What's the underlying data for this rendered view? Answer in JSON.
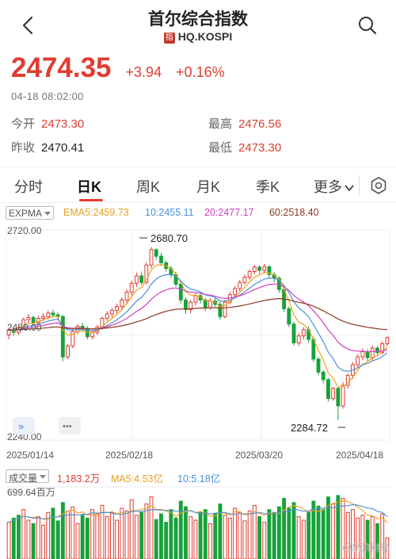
{
  "header": {
    "title": "首尔综合指数",
    "badge": "指",
    "code": "HQ.KOSPI"
  },
  "quote": {
    "price": "2474.35",
    "change": "+3.94",
    "change_pct": "+0.16%",
    "timestamp": "04-18 08:02:00"
  },
  "stats": {
    "open_label": "今开",
    "open_value": "2473.30",
    "prev_label": "昨收",
    "prev_value": "2470.41",
    "high_label": "最高",
    "high_value": "2476.56",
    "low_label": "最低",
    "low_value": "2473.30"
  },
  "tabs": [
    "分时",
    "日K",
    "周K",
    "月K",
    "季K",
    "更多"
  ],
  "active_tab": "日K",
  "indicator": {
    "select": "EXPMA",
    "ema5": "EMA5:2459.73",
    "ema10": "10:2455.11",
    "ema20": "20:2477.17",
    "ema60": "60:2518.40"
  },
  "volume_indicator": {
    "select": "成交量",
    "vol": "1,183.2万",
    "ma5": "MA5:4.53亿",
    "ma10": "10:5.18亿"
  },
  "colors": {
    "up": "#e03c31",
    "down": "#17a23a",
    "ema5": "#f0a020",
    "ema10": "#4a90d9",
    "ema20": "#d040c0",
    "ema60": "#8a3a20"
  },
  "chart_data": {
    "type": "candlestick",
    "y_axis_top": "2720.00",
    "y_axis_bottom": "2240.00",
    "y_axis_mid": "2480.00",
    "ylim": [
      2240,
      2720
    ],
    "high_label": "2680.70",
    "low_label": "2284.72",
    "x_labels": [
      "2025/01/14",
      "2025/02/18",
      "2025/03/20",
      "2025/04/18"
    ],
    "candles": [
      [
        2480,
        2492,
        2470,
        2496
      ],
      [
        2492,
        2486,
        2478,
        2500
      ],
      [
        2486,
        2497,
        2480,
        2505
      ],
      [
        2497,
        2515,
        2492,
        2520
      ],
      [
        2515,
        2520,
        2505,
        2528
      ],
      [
        2520,
        2508,
        2500,
        2525
      ],
      [
        2508,
        2518,
        2502,
        2524
      ],
      [
        2518,
        2522,
        2512,
        2530
      ],
      [
        2522,
        2530,
        2515,
        2536
      ],
      [
        2530,
        2526,
        2520,
        2538
      ],
      [
        2526,
        2522,
        2516,
        2532
      ],
      [
        2522,
        2430,
        2420,
        2526
      ],
      [
        2430,
        2455,
        2425,
        2460
      ],
      [
        2455,
        2488,
        2450,
        2494
      ],
      [
        2488,
        2500,
        2482,
        2505
      ],
      [
        2500,
        2495,
        2488,
        2508
      ],
      [
        2495,
        2476,
        2470,
        2500
      ],
      [
        2476,
        2486,
        2470,
        2492
      ],
      [
        2486,
        2498,
        2480,
        2503
      ],
      [
        2498,
        2518,
        2492,
        2522
      ],
      [
        2518,
        2528,
        2512,
        2534
      ],
      [
        2528,
        2536,
        2520,
        2542
      ],
      [
        2536,
        2545,
        2528,
        2552
      ],
      [
        2545,
        2560,
        2538,
        2566
      ],
      [
        2560,
        2578,
        2552,
        2584
      ],
      [
        2578,
        2598,
        2570,
        2604
      ],
      [
        2598,
        2615,
        2590,
        2622
      ],
      [
        2615,
        2600,
        2594,
        2625
      ],
      [
        2600,
        2640,
        2595,
        2646
      ],
      [
        2640,
        2675,
        2632,
        2681
      ],
      [
        2675,
        2660,
        2652,
        2678
      ],
      [
        2660,
        2645,
        2638,
        2668
      ],
      [
        2645,
        2632,
        2625,
        2650
      ],
      [
        2632,
        2618,
        2610,
        2638
      ],
      [
        2618,
        2596,
        2590,
        2624
      ],
      [
        2596,
        2560,
        2552,
        2602
      ],
      [
        2560,
        2538,
        2528,
        2566
      ],
      [
        2538,
        2555,
        2530,
        2560
      ],
      [
        2555,
        2570,
        2548,
        2578
      ],
      [
        2570,
        2560,
        2552,
        2576
      ],
      [
        2560,
        2542,
        2535,
        2565
      ],
      [
        2542,
        2558,
        2538,
        2564
      ],
      [
        2558,
        2550,
        2544,
        2566
      ],
      [
        2550,
        2522,
        2515,
        2556
      ],
      [
        2522,
        2555,
        2518,
        2560
      ],
      [
        2555,
        2572,
        2550,
        2578
      ],
      [
        2572,
        2586,
        2565,
        2592
      ],
      [
        2586,
        2600,
        2580,
        2606
      ],
      [
        2600,
        2612,
        2595,
        2618
      ],
      [
        2612,
        2625,
        2605,
        2630
      ],
      [
        2625,
        2635,
        2618,
        2640
      ],
      [
        2635,
        2628,
        2620,
        2640
      ],
      [
        2628,
        2636,
        2620,
        2642
      ],
      [
        2636,
        2618,
        2610,
        2640
      ],
      [
        2618,
        2610,
        2600,
        2624
      ],
      [
        2610,
        2584,
        2576,
        2614
      ],
      [
        2584,
        2540,
        2532,
        2588
      ],
      [
        2540,
        2505,
        2498,
        2545
      ],
      [
        2505,
        2462,
        2455,
        2510
      ],
      [
        2462,
        2478,
        2455,
        2484
      ],
      [
        2478,
        2492,
        2470,
        2498
      ],
      [
        2492,
        2470,
        2462,
        2500
      ],
      [
        2470,
        2425,
        2418,
        2476
      ],
      [
        2425,
        2395,
        2388,
        2430
      ],
      [
        2395,
        2378,
        2370,
        2400
      ],
      [
        2378,
        2335,
        2328,
        2382
      ],
      [
        2335,
        2358,
        2330,
        2362
      ],
      [
        2358,
        2318,
        2285,
        2362
      ],
      [
        2318,
        2365,
        2312,
        2372
      ],
      [
        2365,
        2388,
        2358,
        2392
      ],
      [
        2388,
        2412,
        2380,
        2418
      ],
      [
        2412,
        2430,
        2405,
        2436
      ],
      [
        2430,
        2442,
        2422,
        2450
      ],
      [
        2442,
        2428,
        2420,
        2448
      ],
      [
        2428,
        2450,
        2422,
        2456
      ],
      [
        2450,
        2440,
        2432,
        2455
      ],
      [
        2440,
        2460,
        2436,
        2466
      ],
      [
        2460,
        2474,
        2455,
        2477
      ]
    ],
    "volumes": [
      [
        0.52,
        1
      ],
      [
        0.58,
        0
      ],
      [
        0.62,
        0
      ],
      [
        0.7,
        1
      ],
      [
        0.55,
        1
      ],
      [
        0.5,
        0
      ],
      [
        0.6,
        1
      ],
      [
        0.48,
        1
      ],
      [
        0.66,
        1
      ],
      [
        0.72,
        0
      ],
      [
        0.54,
        0
      ],
      [
        0.8,
        0
      ],
      [
        0.68,
        1
      ],
      [
        0.74,
        1
      ],
      [
        0.5,
        1
      ],
      [
        0.62,
        0
      ],
      [
        0.58,
        0
      ],
      [
        0.7,
        1
      ],
      [
        0.64,
        1
      ],
      [
        0.76,
        1
      ],
      [
        0.6,
        1
      ],
      [
        0.66,
        1
      ],
      [
        0.55,
        1
      ],
      [
        0.72,
        1
      ],
      [
        0.68,
        1
      ],
      [
        0.84,
        1
      ],
      [
        0.62,
        1
      ],
      [
        0.66,
        0
      ],
      [
        0.78,
        1
      ],
      [
        0.88,
        1
      ],
      [
        0.56,
        0
      ],
      [
        0.64,
        0
      ],
      [
        0.52,
        0
      ],
      [
        0.7,
        0
      ],
      [
        0.58,
        0
      ],
      [
        0.82,
        0
      ],
      [
        0.74,
        0
      ],
      [
        0.6,
        1
      ],
      [
        0.55,
        1
      ],
      [
        0.66,
        0
      ],
      [
        0.7,
        0
      ],
      [
        0.5,
        1
      ],
      [
        0.64,
        0
      ],
      [
        0.78,
        0
      ],
      [
        0.62,
        1
      ],
      [
        0.58,
        1
      ],
      [
        0.72,
        1
      ],
      [
        0.66,
        1
      ],
      [
        0.54,
        1
      ],
      [
        0.68,
        1
      ],
      [
        0.76,
        1
      ],
      [
        0.6,
        0
      ],
      [
        0.52,
        1
      ],
      [
        0.7,
        0
      ],
      [
        0.66,
        0
      ],
      [
        0.74,
        0
      ],
      [
        0.86,
        0
      ],
      [
        0.72,
        0
      ],
      [
        0.8,
        0
      ],
      [
        0.6,
        1
      ],
      [
        0.55,
        1
      ],
      [
        0.66,
        0
      ],
      [
        0.82,
        0
      ],
      [
        0.75,
        0
      ],
      [
        0.7,
        0
      ],
      [
        0.88,
        0
      ],
      [
        0.78,
        1
      ],
      [
        0.9,
        0
      ],
      [
        0.86,
        1
      ],
      [
        0.66,
        1
      ],
      [
        0.7,
        1
      ],
      [
        0.58,
        1
      ],
      [
        0.62,
        1
      ],
      [
        0.55,
        0
      ],
      [
        0.6,
        1
      ],
      [
        0.5,
        0
      ],
      [
        0.64,
        1
      ],
      [
        0.3,
        1
      ]
    ]
  }
}
